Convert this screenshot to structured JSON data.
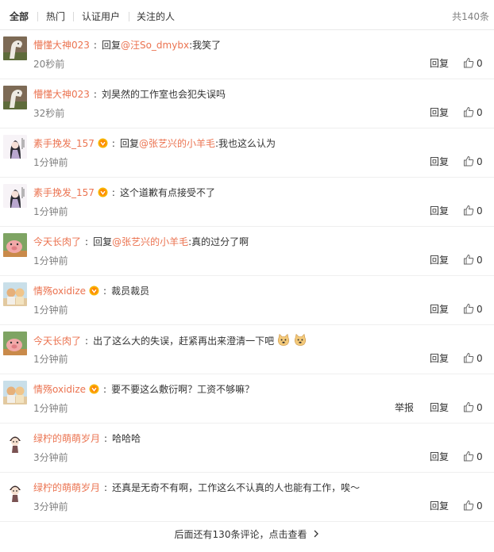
{
  "tabs": [
    {
      "label": "全部",
      "active": true
    },
    {
      "label": "热门",
      "active": false
    },
    {
      "label": "认证用户",
      "active": false
    },
    {
      "label": "关注的人",
      "active": false
    }
  ],
  "total": "共140条",
  "colors": {
    "username": "#eb7350",
    "text": "#333333",
    "muted": "#808080"
  },
  "comments": [
    {
      "user": "懵懂大神023",
      "vip": false,
      "avatar": "horse-photo-avatar",
      "reply_prefix": "回复",
      "mention": "@汪So_dmybx",
      "text": ":我笑了",
      "emojis": [],
      "time": "20秒前",
      "report": "",
      "reply": "回复",
      "likes": "0"
    },
    {
      "user": "懵懂大神023",
      "vip": false,
      "avatar": "horse-photo-avatar",
      "reply_prefix": "",
      "mention": "",
      "text": "刘昊然的工作室也会犯失误吗",
      "emojis": [],
      "time": "32秒前",
      "report": "",
      "reply": "回复",
      "likes": "0"
    },
    {
      "user": "素手挽发_157",
      "vip": true,
      "avatar": "anime-girl-avatar",
      "reply_prefix": "回复",
      "mention": "@张艺兴的小羊毛",
      "text": ":我也这么认为",
      "emojis": [],
      "time": "1分钟前",
      "report": "",
      "reply": "回复",
      "likes": "0"
    },
    {
      "user": "素手挽发_157",
      "vip": true,
      "avatar": "anime-girl-avatar",
      "reply_prefix": "",
      "mention": "",
      "text": "这个道歉有点接受不了",
      "emojis": [],
      "time": "1分钟前",
      "report": "",
      "reply": "回复",
      "likes": "0"
    },
    {
      "user": "今天长肉了",
      "vip": false,
      "avatar": "pig-cartoon-avatar",
      "reply_prefix": "回复",
      "mention": "@张艺兴的小羊毛",
      "text": ":真的过分了啊",
      "emojis": [],
      "time": "1分钟前",
      "report": "",
      "reply": "回复",
      "likes": "0"
    },
    {
      "user": "情殇oxidize",
      "vip": true,
      "avatar": "two-figures-avatar",
      "reply_prefix": "",
      "mention": "",
      "text": "裁员裁员",
      "emojis": [],
      "time": "1分钟前",
      "report": "",
      "reply": "回复",
      "likes": "0"
    },
    {
      "user": "今天长肉了",
      "vip": false,
      "avatar": "pig-cartoon-avatar",
      "reply_prefix": "",
      "mention": "",
      "text": "出了这么大的失误，赶紧再出来澄清一下吧",
      "emojis": [
        "doge-emoji",
        "doge-emoji"
      ],
      "time": "1分钟前",
      "report": "",
      "reply": "回复",
      "likes": "0"
    },
    {
      "user": "情殇oxidize",
      "vip": true,
      "avatar": "two-figures-avatar",
      "reply_prefix": "",
      "mention": "",
      "text": "要不要这么敷衍啊？工资不够嘛？",
      "emojis": [],
      "time": "1分钟前",
      "report": "举报",
      "reply": "回复",
      "likes": "0"
    },
    {
      "user": "绿柠的萌萌岁月",
      "vip": false,
      "avatar": "chibi-character-avatar",
      "reply_prefix": "",
      "mention": "",
      "text": "哈哈哈",
      "emojis": [],
      "time": "3分钟前",
      "report": "",
      "reply": "回复",
      "likes": "0"
    },
    {
      "user": "绿柠的萌萌岁月",
      "vip": false,
      "avatar": "chibi-character-avatar",
      "reply_prefix": "",
      "mention": "",
      "text": "还真是无奇不有啊，工作这么不认真的人也能有工作，唉～",
      "emojis": [],
      "time": "3分钟前",
      "report": "",
      "reply": "回复",
      "likes": "0"
    }
  ],
  "more_link": "后面还有130条评论，点击查看"
}
